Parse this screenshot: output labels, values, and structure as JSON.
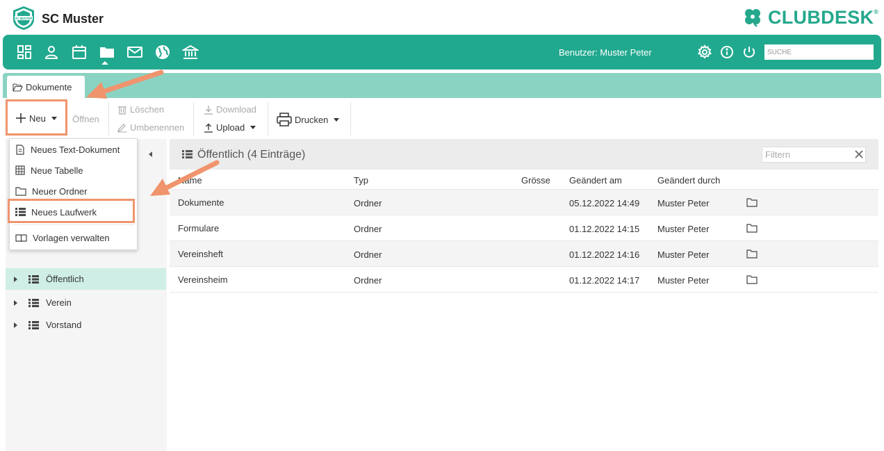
{
  "header": {
    "club_name": "SC Muster",
    "logo_text": "SC MUSTER",
    "brand_name": "CLUBDESK",
    "brand_reg": "®"
  },
  "nav": {
    "items": [
      {
        "name": "dashboard-icon"
      },
      {
        "name": "person-icon"
      },
      {
        "name": "calendar-icon"
      },
      {
        "name": "folder-icon",
        "active": true
      },
      {
        "name": "mail-icon"
      },
      {
        "name": "globe-icon"
      },
      {
        "name": "bank-icon"
      }
    ],
    "user_label": "Benutzer: Muster Peter",
    "search_placeholder": "SUCHE"
  },
  "tabs": [
    {
      "label": "Dokumente",
      "icon": "folder-open-icon"
    }
  ],
  "toolbar": {
    "new_label": "Neu",
    "open_label": "Öffnen",
    "delete_label": "Löschen",
    "rename_label": "Umbenennen",
    "download_label": "Download",
    "upload_label": "Upload",
    "print_label": "Drucken"
  },
  "menu": {
    "items": [
      {
        "label": "Neues Text-Dokument",
        "icon": "document-icon"
      },
      {
        "label": "Neue Tabelle",
        "icon": "table-icon"
      },
      {
        "label": "Neuer Ordner",
        "icon": "folder-icon"
      },
      {
        "label": "Neues Laufwerk",
        "icon": "drive-icon",
        "highlighted": true
      },
      {
        "label": "Vorlagen verwalten",
        "icon": "book-icon"
      }
    ]
  },
  "tree": {
    "items": [
      {
        "label": "Öffentlich",
        "selected": true
      },
      {
        "label": "Verein"
      },
      {
        "label": "Vorstand"
      }
    ]
  },
  "list": {
    "title": "Öffentlich (4 Einträge)",
    "filter_placeholder": "Filtern",
    "columns": [
      "Name",
      "Typ",
      "Grösse",
      "Geändert am",
      "Geändert durch"
    ],
    "rows": [
      {
        "name": "Dokumente",
        "type": "Ordner",
        "size": "",
        "modified": "05.12.2022 14:49",
        "by": "Muster Peter"
      },
      {
        "name": "Formulare",
        "type": "Ordner",
        "size": "",
        "modified": "01.12.2022 14:15",
        "by": "Muster Peter"
      },
      {
        "name": "Vereinsheft",
        "type": "Ordner",
        "size": "",
        "modified": "01.12.2022 14:16",
        "by": "Muster Peter"
      },
      {
        "name": "Vereinsheim",
        "type": "Ordner",
        "size": "",
        "modified": "01.12.2022 14:17",
        "by": "Muster Peter"
      }
    ]
  },
  "colors": {
    "brand": "#21a98f",
    "tab_strip": "#8ad3c2",
    "selection": "#cfeee6",
    "annotation": "#f0946d"
  }
}
